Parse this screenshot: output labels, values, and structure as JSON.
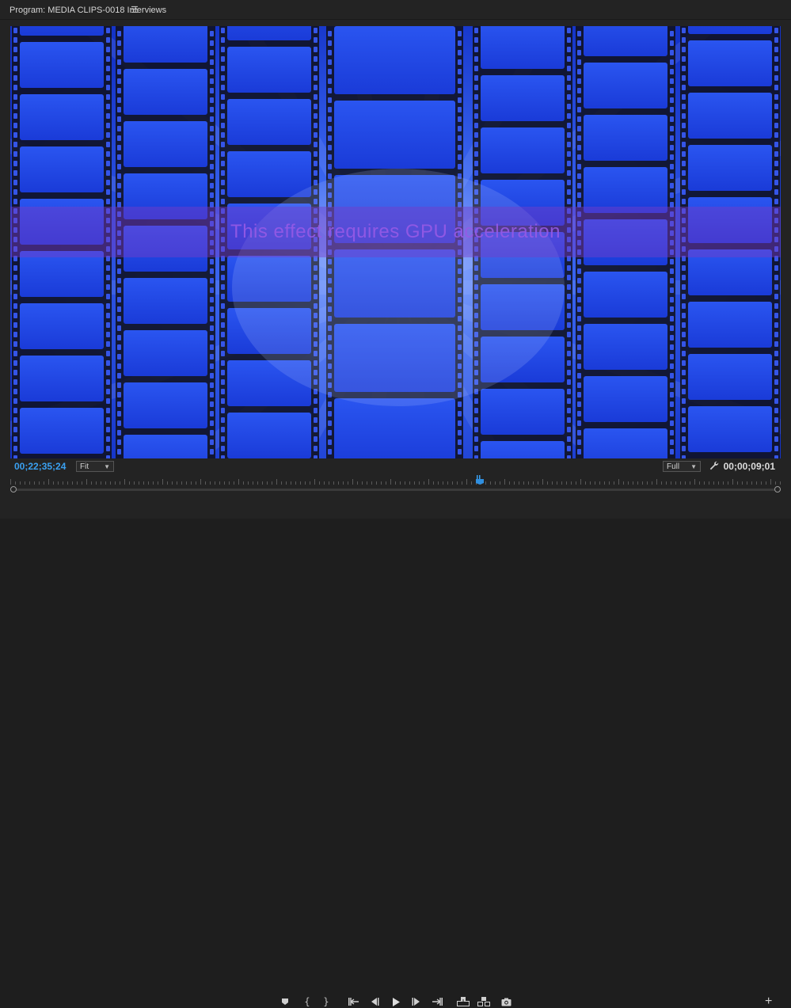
{
  "panel": {
    "title": "Program: MEDIA CLIPS-0018 Interviews",
    "menu_icon": "hamburger-menu-icon"
  },
  "viewer": {
    "overlay_message": "This effect requires GPU acceleration",
    "accent": "#1e44e0"
  },
  "timecode": {
    "current": "00;22;35;24",
    "duration": "00;00;09;01",
    "current_color": "#3aa0f0"
  },
  "zoom": {
    "selected": "Fit"
  },
  "resolution": {
    "selected": "Full"
  },
  "scrubber": {
    "playhead_fraction": 0.606
  },
  "transport": {
    "buttons": [
      "add-marker-icon",
      "mark-in-icon",
      "mark-out-icon",
      "go-to-in-icon",
      "step-back-icon",
      "play-icon",
      "step-forward-icon",
      "go-to-out-icon",
      "lift-icon",
      "extract-icon",
      "export-frame-icon"
    ],
    "add_symbol": "+"
  }
}
